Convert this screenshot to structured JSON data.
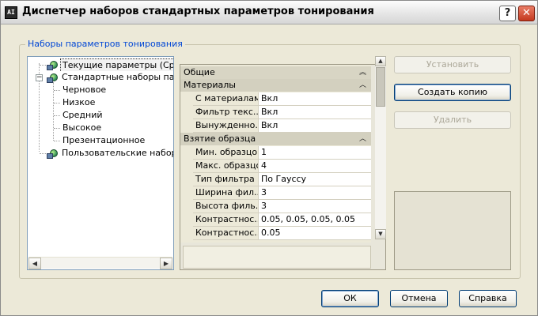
{
  "window": {
    "title": "Диспетчер наборов стандартных параметров тонирования",
    "icon_label": "AI",
    "help_glyph": "?",
    "close_glyph": "✕"
  },
  "group": {
    "legend": "Наборы параметров тонирования"
  },
  "tree": {
    "items": [
      {
        "label": "Текущие параметры (Средн",
        "selected": true,
        "icon": "render-preset-icon"
      },
      {
        "label": "Стандартные наборы парам",
        "icon": "render-preset-icon",
        "expander": "−"
      },
      {
        "label": "Черновое"
      },
      {
        "label": "Низкое"
      },
      {
        "label": "Средний"
      },
      {
        "label": "Высокое"
      },
      {
        "label": "Презентационное"
      },
      {
        "label": "Пользовательские наборы",
        "icon": "render-preset-icon"
      }
    ],
    "scroll_left": "◀",
    "scroll_right": "▶"
  },
  "properties": {
    "header": "Общие",
    "header_chevron": "︽",
    "categories": [
      {
        "name": "Материалы",
        "rows": [
          {
            "name": "С материалами",
            "value": "Вкл"
          },
          {
            "name": "Фильтр текс...",
            "value": "Вкл"
          },
          {
            "name": "Вынужденно...",
            "value": "Вкл"
          }
        ]
      },
      {
        "name": "Взятие образца",
        "rows": [
          {
            "name": "Мин. образцов",
            "value": "1"
          },
          {
            "name": "Макс. образцов",
            "value": "4"
          },
          {
            "name": "Тип фильтра",
            "value": "По Гауссу"
          },
          {
            "name": "Ширина фил...",
            "value": "3"
          },
          {
            "name": "Высота филь...",
            "value": "3"
          },
          {
            "name": "Контрастнос...",
            "value": "0.05, 0.05, 0.05, 0.05"
          },
          {
            "name": "Контрастнос...",
            "value": "0.05"
          }
        ]
      }
    ],
    "chevron": "︿",
    "scroll_up": "▲",
    "scroll_down": "▼"
  },
  "buttons": {
    "set_current": "Установить",
    "create_copy": "Создать копию",
    "delete": "Удалить",
    "ok": "ОК",
    "cancel": "Отмена",
    "help": "Справка"
  }
}
